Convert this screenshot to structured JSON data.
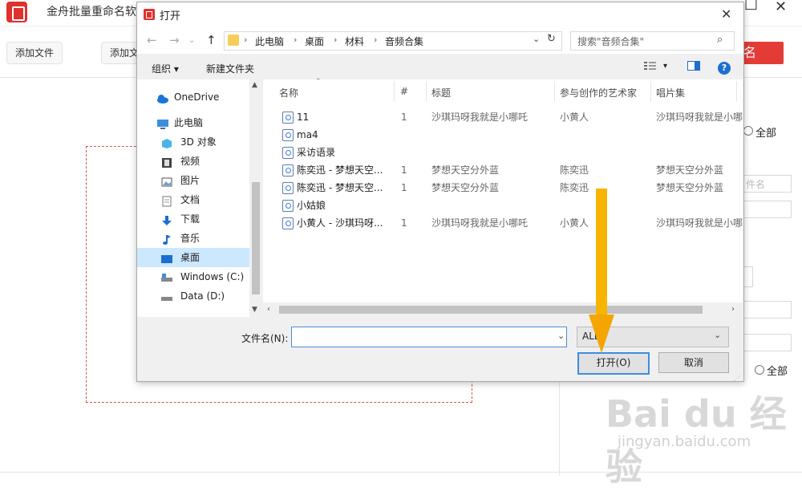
{
  "app": {
    "title": "金舟批量重命名软件",
    "add_file": "添加文件",
    "add_folder": "添加文件夹",
    "start_btn": "开始重命名",
    "right_labels": {
      "all_1": "全部",
      "all_2": "全部",
      "filename": "件名"
    }
  },
  "dialog": {
    "title": "打开",
    "breadcrumb": [
      "此电脑",
      "桌面",
      "材料",
      "音频合集"
    ],
    "search_placeholder": "搜索\"音频合集\"",
    "toolbar": {
      "organize": "组织 ▾",
      "new_folder": "新建文件夹"
    },
    "nav": [
      {
        "label": "OneDrive",
        "icon": "cloud-icon"
      },
      {
        "label": "此电脑",
        "icon": "computer-icon"
      },
      {
        "label": "3D 对象",
        "icon": "3d-objects-icon"
      },
      {
        "label": "视频",
        "icon": "video-icon"
      },
      {
        "label": "图片",
        "icon": "picture-icon"
      },
      {
        "label": "文档",
        "icon": "document-icon"
      },
      {
        "label": "下载",
        "icon": "download-icon"
      },
      {
        "label": "音乐",
        "icon": "music-icon"
      },
      {
        "label": "桌面",
        "icon": "desktop-icon",
        "selected": true
      },
      {
        "label": "Windows (C:)",
        "icon": "drive-icon"
      },
      {
        "label": "Data (D:)",
        "icon": "drive-icon"
      }
    ],
    "columns": [
      "名称",
      "#",
      "标题",
      "参与创作的艺术家",
      "唱片集"
    ],
    "files": [
      {
        "name": "11",
        "num": "1",
        "title": "沙琪玛呀我就是小哪吒",
        "artist": "小黄人",
        "album": "沙琪玛呀我就是小哪"
      },
      {
        "name": "ma4",
        "num": "",
        "title": "",
        "artist": "",
        "album": ""
      },
      {
        "name": "采访语录",
        "num": "",
        "title": "",
        "artist": "",
        "album": ""
      },
      {
        "name": "陈奕迅 - 梦想天空...",
        "num": "1",
        "title": "梦想天空分外蓝",
        "artist": "陈奕迅",
        "album": "梦想天空分外蓝"
      },
      {
        "name": "陈奕迅 - 梦想天空...",
        "num": "1",
        "title": "梦想天空分外蓝",
        "artist": "陈奕迅",
        "album": "梦想天空分外蓝"
      },
      {
        "name": "小姑娘",
        "num": "",
        "title": "",
        "artist": "",
        "album": ""
      },
      {
        "name": "小黄人 - 沙琪玛呀...",
        "num": "1",
        "title": "沙琪玛呀我就是小哪吒",
        "artist": "小黄人",
        "album": "沙琪玛呀我就是小哪"
      }
    ],
    "filename_label": "文件名(N):",
    "filename_value": "",
    "filetype": "ALL",
    "open_btn": "打开(O)",
    "cancel_btn": "取消"
  },
  "watermark": {
    "main": "Bai du 经验",
    "sub": "jingyan.baidu.com"
  },
  "colors": {
    "accent_red": "#e33c36",
    "arrow": "#f5a500",
    "selection": "#cce8ff"
  }
}
